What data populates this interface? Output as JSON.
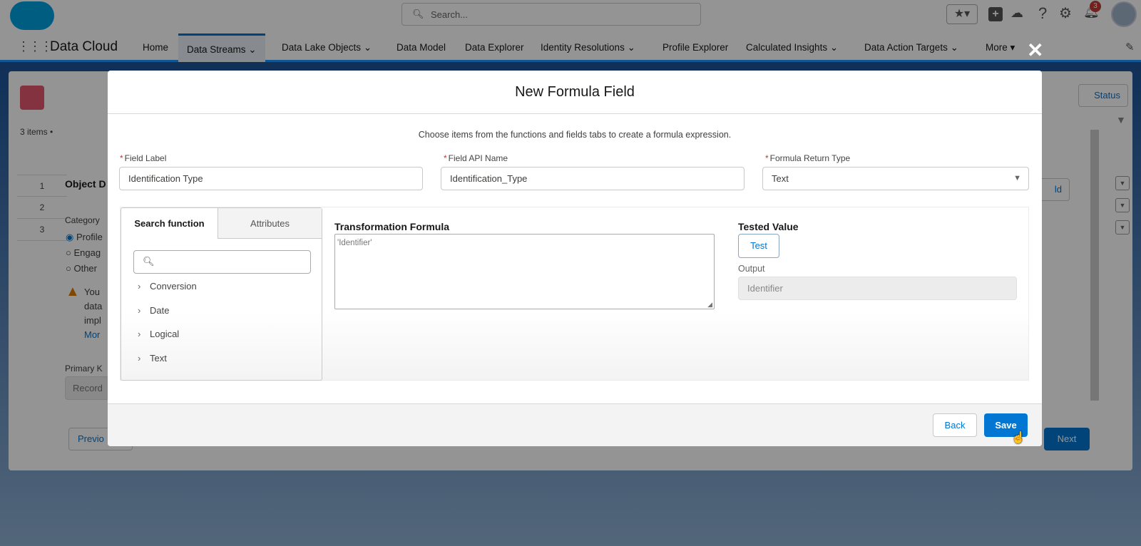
{
  "app": {
    "name": "Data Cloud",
    "search_placeholder": "Search...",
    "notification_count": "3",
    "nav": [
      {
        "label": "Home",
        "has_menu": false
      },
      {
        "label": "Data Streams",
        "has_menu": true,
        "active": true
      },
      {
        "label": "Data Lake Objects",
        "has_menu": true
      },
      {
        "label": "Data Model",
        "has_menu": false
      },
      {
        "label": "Data Explorer",
        "has_menu": false
      },
      {
        "label": "Identity Resolutions",
        "has_menu": true
      },
      {
        "label": "Profile Explorer",
        "has_menu": false
      },
      {
        "label": "Calculated Insights",
        "has_menu": true
      },
      {
        "label": "Data Action Targets",
        "has_menu": true
      },
      {
        "label": "More",
        "has_menu": true
      }
    ],
    "background": {
      "items_count": "3 items •",
      "rows": [
        "1",
        "2",
        "3"
      ],
      "section_title": "Object D",
      "category_label": "Category",
      "radios": [
        "Profile",
        "Engag",
        "Other"
      ],
      "warning_lines": [
        "You",
        "data",
        "impl",
        "Mor"
      ],
      "primary_key_label": "Primary K",
      "primary_key_value": "Record",
      "previous_button": "Previo",
      "status_button": "Status",
      "add_button": "ld",
      "next_button": "Next"
    }
  },
  "modal": {
    "title": "New Formula Field",
    "instructions": "Choose items from the functions and fields tabs to create a formula expression.",
    "field_label": {
      "label": "Field Label",
      "value": "Identification Type"
    },
    "field_api_name": {
      "label": "Field API Name",
      "value": "Identification_Type"
    },
    "return_type": {
      "label": "Formula Return Type",
      "value": "Text"
    },
    "tabs": [
      {
        "label": "Search function",
        "active": true
      },
      {
        "label": "Attributes",
        "active": false
      }
    ],
    "search_value": "",
    "function_categories": [
      "Conversion",
      "Date",
      "Logical",
      "Text"
    ],
    "formula": {
      "heading": "Transformation Formula",
      "value": "'Identifier'"
    },
    "tested": {
      "heading": "Tested Value",
      "test_button": "Test",
      "output_label": "Output",
      "output_value": "Identifier"
    },
    "back_button": "Back",
    "save_button": "Save"
  },
  "colors": {
    "brand": "#0176d3",
    "required": "#c23934"
  }
}
